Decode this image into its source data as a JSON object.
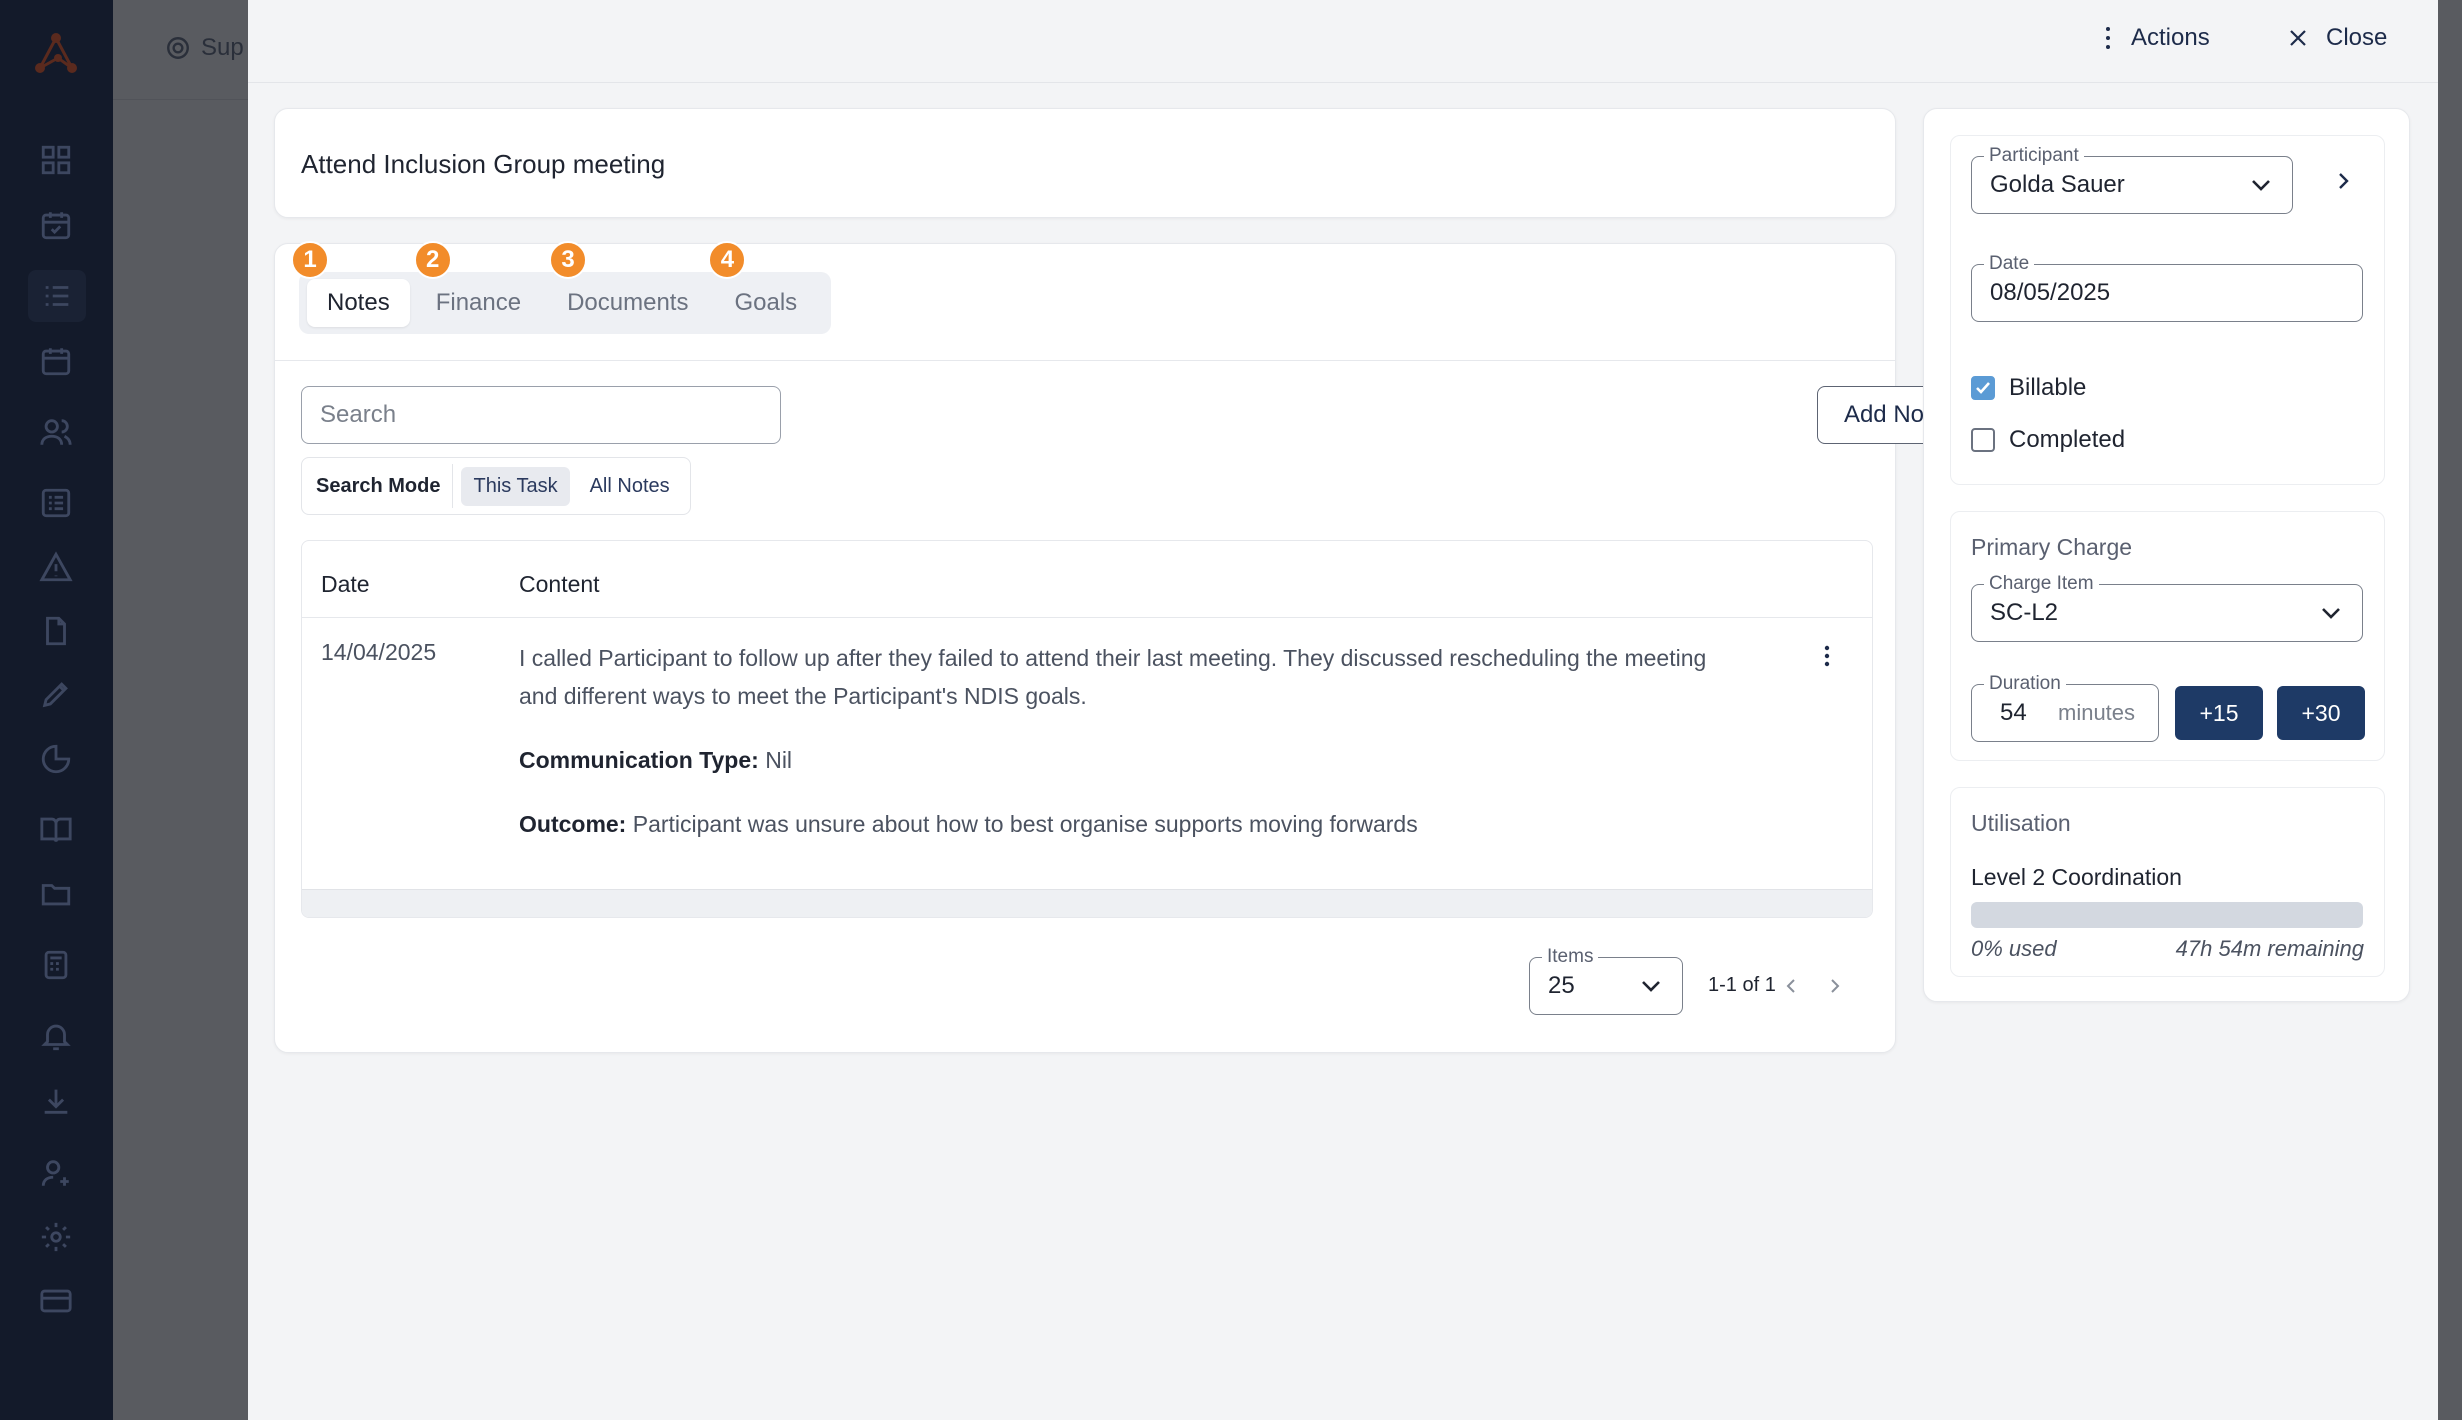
{
  "background": {
    "breadcrumb": "Sup"
  },
  "drawer": {
    "actions_label": "Actions",
    "close_label": "Close"
  },
  "task": {
    "title": "Attend Inclusion Group meeting"
  },
  "tabs": [
    {
      "label": "Notes",
      "badge": "1",
      "active": true
    },
    {
      "label": "Finance",
      "badge": "2",
      "active": false
    },
    {
      "label": "Documents",
      "badge": "3",
      "active": false
    },
    {
      "label": "Goals",
      "badge": "4",
      "active": false
    }
  ],
  "notes": {
    "search_placeholder": "Search",
    "add_note_label": "Add Note",
    "search_mode_label": "Search Mode",
    "search_mode_options": [
      "This Task",
      "All Notes"
    ],
    "columns": [
      "Date",
      "Content"
    ],
    "rows": [
      {
        "date": "14/04/2025",
        "content": "I called Participant to follow up after they failed to attend their last meeting. They discussed rescheduling the meeting and different ways to meet the Participant's NDIS goals.",
        "communication_type_label": "Communication Type:",
        "communication_type_value": "Nil",
        "outcome_label": "Outcome:",
        "outcome_value": "Participant was unsure about how to best organise supports moving forwards"
      }
    ],
    "items_label": "Items",
    "items_value": "25",
    "pagination_text": "1-1 of 1"
  },
  "side": {
    "participant_label": "Participant",
    "participant_value": "Golda Sauer",
    "date_label": "Date",
    "date_value": "08/05/2025",
    "billable_label": "Billable",
    "billable_checked": true,
    "completed_label": "Completed",
    "completed_checked": false,
    "primary_charge_title": "Primary Charge",
    "charge_item_label": "Charge Item",
    "charge_item_value": "SC-L2",
    "duration_label": "Duration",
    "duration_value": "54",
    "duration_unit": "minutes",
    "plus15_label": "+15",
    "plus30_label": "+30",
    "utilisation_title": "Utilisation",
    "utilisation_item": "Level 2 Coordination",
    "utilisation_used_fraction": 0,
    "utilisation_used_text": "0% used",
    "utilisation_remaining_text": "47h 54m remaining"
  },
  "colors": {
    "accent_orange": "#f28c2a",
    "primary_navy": "#1e3a66",
    "checkbox_blue": "#5b9bd5",
    "nav_bg": "#131a2a"
  },
  "icons": {
    "nav": [
      "dashboard-icon",
      "calendar-check-icon",
      "list-icon",
      "calendar-icon",
      "users-icon",
      "checklist-icon",
      "warning-icon",
      "file-icon",
      "pen-icon",
      "pie-chart-icon",
      "book-icon",
      "folder-icon",
      "calculator-icon",
      "bell-icon",
      "download-icon",
      "user-gear-icon",
      "settings-icon",
      "credit-card-icon"
    ]
  }
}
